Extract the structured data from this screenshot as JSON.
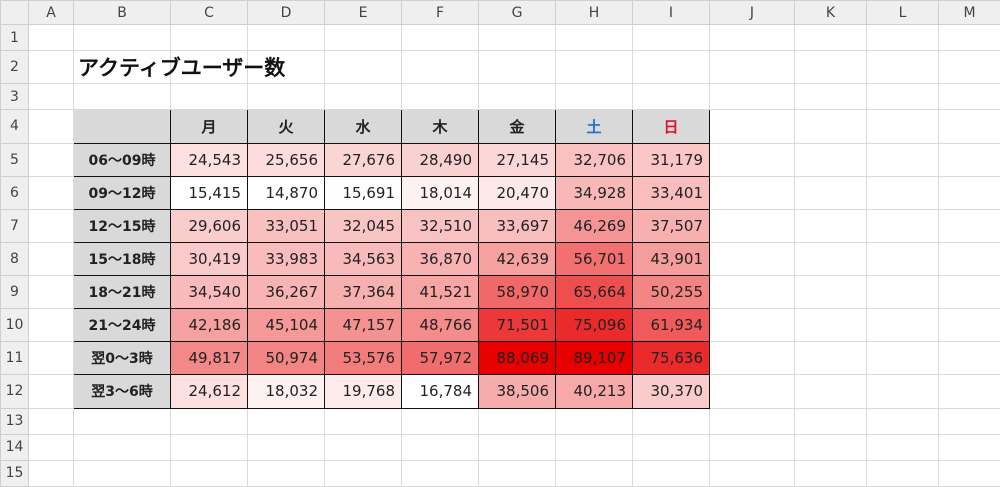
{
  "spreadsheet": {
    "column_headers": [
      "A",
      "B",
      "C",
      "D",
      "E",
      "F",
      "G",
      "H",
      "I",
      "J",
      "K",
      "L",
      "M"
    ],
    "row_numbers": [
      "1",
      "2",
      "3",
      "4",
      "5",
      "6",
      "7",
      "8",
      "9",
      "10",
      "11",
      "12",
      "13",
      "14",
      "15"
    ],
    "title": "アクティブユーザー数",
    "day_headers": [
      "月",
      "火",
      "水",
      "木",
      "金",
      "土",
      "日"
    ],
    "rows": [
      {
        "slot": "06～09時",
        "values": [
          "24,543",
          "25,656",
          "27,676",
          "28,490",
          "27,145",
          "32,706",
          "31,179"
        ],
        "colors": [
          "#fde1e1",
          "#fcdcdc",
          "#fbd4d4",
          "#fad1d1",
          "#fbd6d6",
          "#f9c1c1",
          "#fac6c6"
        ]
      },
      {
        "slot": "09～12時",
        "values": [
          "15,415",
          "14,870",
          "15,691",
          "18,014",
          "20,470",
          "34,928",
          "33,401"
        ],
        "colors": [
          "#ffffff",
          "#ffffff",
          "#fefefe",
          "#fdf2f2",
          "#fde9e9",
          "#f8b8b8",
          "#f9bdbd"
        ]
      },
      {
        "slot": "12～15時",
        "values": [
          "29,606",
          "33,051",
          "32,045",
          "32,510",
          "33,697",
          "46,269",
          "37,507"
        ],
        "colors": [
          "#facdcd",
          "#f9c0c0",
          "#f9c4c4",
          "#f9c2c2",
          "#f8bdbd",
          "#f59494",
          "#f7b0b0"
        ]
      },
      {
        "slot": "15～18時",
        "values": [
          "30,419",
          "33,983",
          "34,563",
          "36,870",
          "42,639",
          "56,701",
          "43,901"
        ],
        "colors": [
          "#facaca",
          "#f8bcbc",
          "#f8baba",
          "#f8b2b2",
          "#f6a0a0",
          "#f27070",
          "#f59c9c"
        ]
      },
      {
        "slot": "18～21時",
        "values": [
          "34,540",
          "36,267",
          "37,364",
          "41,521",
          "58,970",
          "65,664",
          "50,255"
        ],
        "colors": [
          "#f8baba",
          "#f8b4b4",
          "#f7b0b0",
          "#f6a4a4",
          "#f16868",
          "#ee4e4e",
          "#f38585"
        ]
      },
      {
        "slot": "21～24時",
        "values": [
          "42,186",
          "45,104",
          "47,157",
          "48,766",
          "71,501",
          "75,096",
          "61,934"
        ],
        "colors": [
          "#f6a1a1",
          "#f59898",
          "#f49292",
          "#f48c8c",
          "#ec3838",
          "#eb2b2b",
          "#f05a5a"
        ]
      },
      {
        "slot": "翌0～3時",
        "values": [
          "49,817",
          "50,974",
          "53,576",
          "57,972",
          "88,069",
          "89,107",
          "75,636"
        ],
        "colors": [
          "#f38888",
          "#f38484",
          "#f27c7c",
          "#f16c6c",
          "#e60000",
          "#e60000",
          "#eb2b2b"
        ]
      },
      {
        "slot": "翌3～6時",
        "values": [
          "24,612",
          "18,032",
          "19,768",
          "16,784",
          "38,506",
          "40,213",
          "30,370"
        ],
        "colors": [
          "#fde1e1",
          "#fdf1f1",
          "#fdebeb",
          "#ffffff",
          "#f7acac",
          "#f7a8a8",
          "#facbcb"
        ]
      }
    ],
    "colors": {
      "header_bg": "#efefef",
      "table_header_bg": "#d9d9d9",
      "saturday": "#1f6fd0",
      "sunday": "#e0102a",
      "heat_max": "#e60000"
    }
  }
}
